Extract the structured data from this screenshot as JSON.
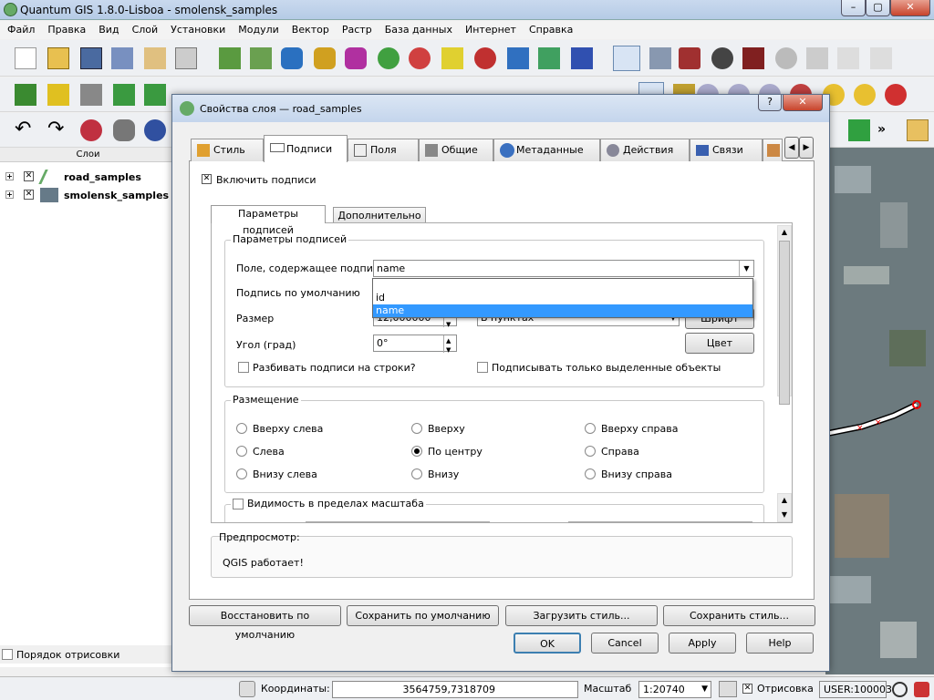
{
  "window": {
    "title": "Quantum GIS 1.8.0-Lisboa - smolensk_samples",
    "min": "–",
    "max": "▢",
    "close": "✕"
  },
  "menu": [
    "Файл",
    "Правка",
    "Вид",
    "Слой",
    "Установки",
    "Модули",
    "Вектор",
    "Растр",
    "База данных",
    "Интернет",
    "Справка"
  ],
  "layers_panel": {
    "title": "Слои",
    "layers": [
      {
        "name": "road_samples"
      },
      {
        "name": "smolensk_samples"
      }
    ],
    "order_label": "Порядок отрисовки"
  },
  "dialog": {
    "title": "Свойства слоя — road_samples",
    "help_btn": "?",
    "close_btn": "✕",
    "tabs": [
      "Стиль",
      "Подписи",
      "Поля",
      "Общие",
      "Метаданные",
      "Действия",
      "Связи"
    ],
    "enable_labels": "Включить подписи",
    "subtabs": [
      "Параметры подписей",
      "Дополнительно"
    ],
    "label_params": {
      "group_title": "Параметры подписей",
      "field_label": "Поле, содержащее подпись",
      "field_value": "name",
      "dropdown_options": [
        "id",
        "name"
      ],
      "default_label": "Подпись по умолчанию",
      "size_label": "Размер",
      "size_value": "12,000000",
      "size_units": "В пунктах",
      "font_btn": "Шрифт",
      "angle_label": "Угол (град)",
      "angle_value": "0°",
      "color_btn": "Цвет",
      "wrap_label": "Разбивать подписи на строки?",
      "selected_only_label": "Подписывать только выделенные объекты"
    },
    "placement": {
      "group_title": "Размещение",
      "options": [
        "Вверху слева",
        "Вверху",
        "Вверху справа",
        "Слева",
        "По центру",
        "Справа",
        "Внизу слева",
        "Внизу",
        "Внизу справа"
      ],
      "selected": "По центру"
    },
    "scale_visibility": "Видимость в пределах масштаба",
    "preview_title": "Предпросмотр:",
    "preview_text": "QGIS работает!",
    "buttons_row1": [
      "Восстановить по умолчанию",
      "Сохранить по умолчанию",
      "Загрузить стиль...",
      "Сохранить стиль..."
    ],
    "buttons_row2": [
      "OK",
      "Cancel",
      "Apply",
      "Help"
    ]
  },
  "status": {
    "coord_label": "Координаты:",
    "coord_value": "3564759,7318709",
    "scale_label": "Масштаб",
    "scale_value": "1:20740",
    "render_label": "Отрисовка",
    "crs": "USER:100003"
  }
}
